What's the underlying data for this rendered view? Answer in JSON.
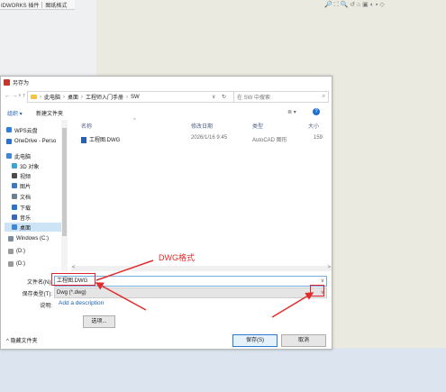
{
  "app": {
    "tabs": [
      "IDWORKS 插件",
      "图纸格式"
    ],
    "toolbar_icons": "🔎 ⛶ 🔍 ↺ ⌂ ▣ ◐ ▪ ◇"
  },
  "dialog": {
    "title": "另存为",
    "nav": {
      "back": "←",
      "forward": "→",
      "down": "∨",
      "up": "↑"
    },
    "breadcrumb": [
      "此电脑",
      "桌面",
      "工程师入门手册",
      "SW"
    ],
    "addr_chevron": "∨",
    "refresh": "↻",
    "search_placeholder": "在 SW 中搜索",
    "search_icon": "⌕",
    "organize": "组织 ▾",
    "new_folder": "新建文件夹",
    "view_icon": "≣ ▾",
    "help": "?",
    "nav_items": [
      {
        "label": "WPS云盘",
        "color": "#2f7fe0"
      },
      {
        "label": "OneDrive - Perso",
        "color": "#2a71d0"
      },
      {
        "label": "此电脑",
        "color": "#3c87d8"
      },
      {
        "label": "3D 对象",
        "color": "#3aa6d8"
      },
      {
        "label": "视频",
        "color": "#4b4b4b"
      },
      {
        "label": "图片",
        "color": "#3b78c4"
      },
      {
        "label": "文档",
        "color": "#6f7f92"
      },
      {
        "label": "下载",
        "color": "#2a71d0"
      },
      {
        "label": "音乐",
        "color": "#3a66c0"
      },
      {
        "label": "桌面",
        "color": "#3c87d8"
      },
      {
        "label": "Windows (C:)",
        "color": "#7a8ca0"
      },
      {
        "label": "(D:)",
        "color": "#9a9a9a"
      },
      {
        "label": "(D:)",
        "color": "#9a9a9a"
      }
    ],
    "columns": {
      "name": "名称",
      "date": "修改日期",
      "type": "类型",
      "size": "大小"
    },
    "sort_caret": "^",
    "files": [
      {
        "name": "工程图.DWG",
        "date": "2026/1/16 9:45",
        "type": "AutoCAD 图形",
        "size": "159"
      }
    ],
    "hscroll_left": "<",
    "hscroll_right": ">",
    "filename_label": "文件名(N):",
    "filename_value": "工程图.DWG",
    "filename_chevron": "∨",
    "filetype_label": "保存类型(T):",
    "filetype_value": "Dwg (*.dwg)",
    "filetype_chevron": "∨",
    "desc_label": "说明:",
    "desc_link": "Add a description",
    "options_button": "选项...",
    "hide_folders": "隐藏文件夹",
    "hide_caret": "^",
    "save_button": "保存(S)",
    "cancel_button": "取消"
  },
  "annotation": {
    "text": "DWG格式",
    "color": "#e02c2c"
  }
}
